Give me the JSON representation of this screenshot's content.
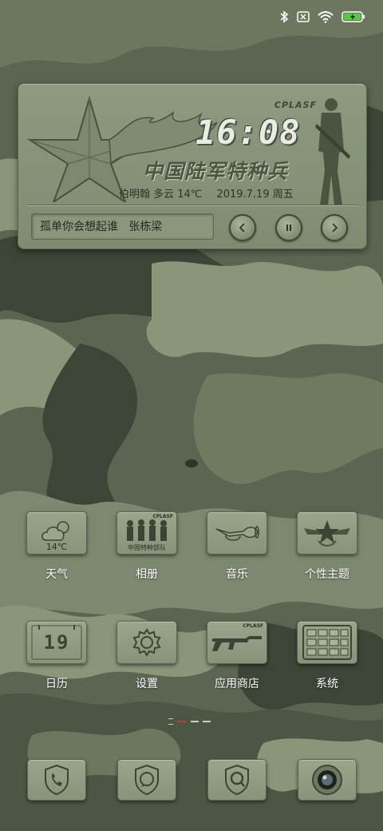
{
  "status_bar": {
    "icons": [
      "bluetooth-icon",
      "sim-none-icon",
      "wifi-icon",
      "battery-charging-icon"
    ],
    "battery_color": "#4cd137"
  },
  "widget": {
    "badge": "CPLASF",
    "time": "16:08",
    "title": "中国陆军特种兵",
    "weather": "伯明翰 多云 14℃",
    "date": "2019.7.19 周五",
    "song": "孤单你会想起谁",
    "artist": "张栋梁",
    "controls": [
      "previous-icon",
      "pause-icon",
      "next-icon"
    ]
  },
  "apps": [
    {
      "label": "天气",
      "icon": "weather-cloud-icon",
      "temp": "14℃"
    },
    {
      "label": "相册",
      "icon": "soldiers-photo-icon",
      "badge": "CPLASF",
      "caption": "中国特种部队"
    },
    {
      "label": "音乐",
      "icon": "bugle-icon"
    },
    {
      "label": "个性主题",
      "icon": "army-star-emblem-icon"
    },
    {
      "label": "日历",
      "icon": "calendar-icon",
      "day": "19"
    },
    {
      "label": "设置",
      "icon": "gear-icon"
    },
    {
      "label": "应用商店",
      "icon": "rifle-icon",
      "badge": "CPLASF"
    },
    {
      "label": "系统",
      "icon": "system-grid-icon"
    }
  ],
  "page_indicator": {
    "pages": 3,
    "active": 0
  },
  "dock": [
    {
      "icon": "phone-icon"
    },
    {
      "icon": "messages-icon"
    },
    {
      "icon": "browser-icon"
    },
    {
      "icon": "camera-icon"
    }
  ],
  "colors": {
    "camo_base": "#5c6552",
    "camo_light": "#8a9579",
    "camo_dark": "#3d4536",
    "tile": "#8f9b82",
    "indicator_active": "#c0392b"
  }
}
